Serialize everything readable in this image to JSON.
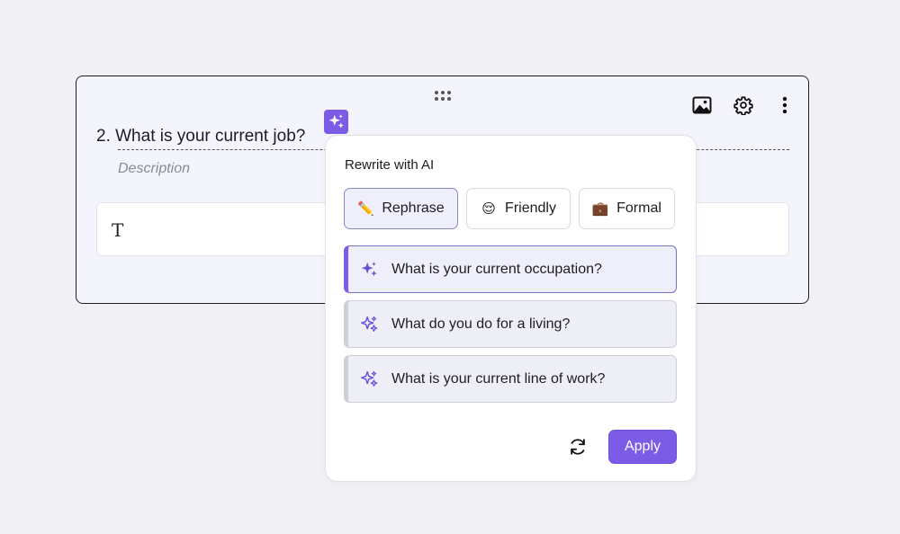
{
  "question": {
    "title": "2. What is your current job?",
    "description": "Description",
    "answer_type_glyph": "T"
  },
  "toolbar": {
    "icons": [
      "image-icon",
      "gear-icon",
      "more-vertical-icon"
    ]
  },
  "popup": {
    "title": "Rewrite with AI",
    "tones": [
      {
        "label": "Rephrase",
        "icon": "pencil-icon",
        "emoji": "✏️",
        "active": true
      },
      {
        "label": "Friendly",
        "icon": "smile-icon",
        "emoji": "😌",
        "active": false
      },
      {
        "label": "Formal",
        "icon": "briefcase-icon",
        "emoji": "💼",
        "active": false
      }
    ],
    "suggestions": [
      {
        "text": "What is your current occupation?",
        "selected": true
      },
      {
        "text": "What do you do for a living?",
        "selected": false
      },
      {
        "text": "What is your current line of work?",
        "selected": false
      }
    ],
    "apply_label": "Apply"
  },
  "colors": {
    "accent": "#7c5ce6",
    "card_bg": "#f4f4fc",
    "page_bg": "#f1f1f5"
  }
}
